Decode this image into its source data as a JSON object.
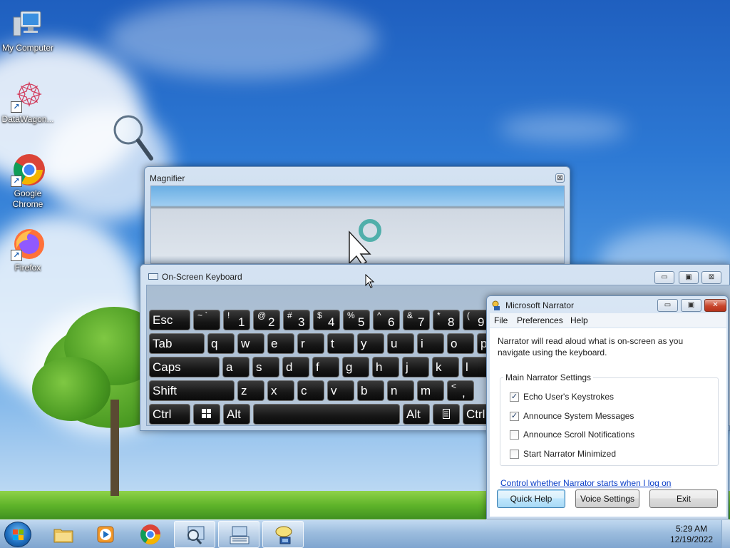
{
  "desktop": {
    "icons": [
      {
        "label": "My Computer"
      },
      {
        "label": "DataWagon..."
      },
      {
        "label": "Google Chrome"
      },
      {
        "label": "Firefox"
      }
    ]
  },
  "magnifier": {
    "title": "Magnifier",
    "close_glyph": "⊠"
  },
  "osk": {
    "title": "On-Screen Keyboard",
    "minimize_glyph": "▭",
    "maximize_glyph": "▣",
    "close_glyph": "⊠",
    "rows": [
      [
        "Esc",
        "~ `",
        "! 1",
        "@ 2",
        "# 3",
        "$ 4",
        "% 5",
        "^ 6",
        "& 7",
        "* 8",
        "( 9"
      ],
      [
        "Tab",
        "q",
        "w",
        "e",
        "r",
        "t",
        "y",
        "u",
        "i",
        "o",
        "p"
      ],
      [
        "Caps",
        "a",
        "s",
        "d",
        "f",
        "g",
        "h",
        "j",
        "k",
        "l"
      ],
      [
        "Shift",
        "z",
        "x",
        "c",
        "v",
        "b",
        "n",
        "m",
        "< ,"
      ],
      [
        "Ctrl",
        "win",
        "Alt",
        "",
        "Alt",
        "menu",
        "Ctrl"
      ]
    ]
  },
  "narrator": {
    "title": "Microsoft Narrator",
    "menu": [
      "File",
      "Preferences",
      "Help"
    ],
    "description": "Narrator will read aloud what is on-screen as you navigate using the keyboard.",
    "group_label": "Main Narrator Settings",
    "options": [
      {
        "label": "Echo User's Keystrokes",
        "checked": true
      },
      {
        "label": "Announce System Messages",
        "checked": true
      },
      {
        "label": "Announce Scroll Notifications",
        "checked": false
      },
      {
        "label": "Start Narrator Minimized",
        "checked": false
      }
    ],
    "link": "Control whether Narrator starts when I log on",
    "buttons": {
      "quick_help": "Quick Help",
      "voice_settings": "Voice Settings",
      "exit": "Exit"
    },
    "minimize_glyph": "▭",
    "maximize_glyph": "▣",
    "close_glyph": "✕"
  },
  "taskbar": {
    "items": [
      "explorer",
      "media-player",
      "chrome",
      "magnifier",
      "on-screen-keyboard",
      "narrator"
    ],
    "clock": {
      "time": "5:29 AM",
      "date": "12/19/2022"
    }
  },
  "colors": {
    "accent": "#1f6fc0",
    "link": "#0a3ec8",
    "close_button": "#c8462c"
  }
}
